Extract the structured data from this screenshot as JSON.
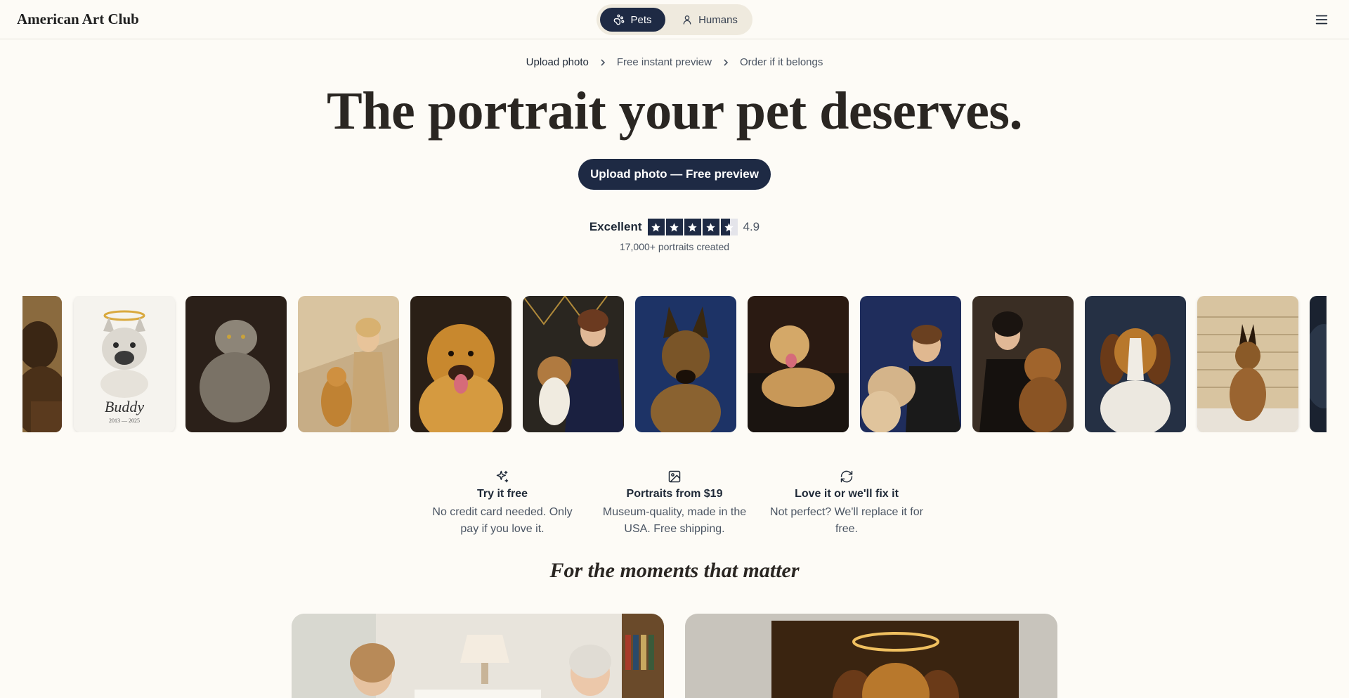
{
  "header": {
    "brand": "American Art Club",
    "toggle": [
      {
        "label": "Pets",
        "icon": "paw-icon",
        "active": true
      },
      {
        "label": "Humans",
        "icon": "person-icon",
        "active": false
      }
    ],
    "menu_icon": "menu-icon"
  },
  "steps": [
    {
      "label": "Upload photo",
      "active": true
    },
    {
      "label": "Free instant preview",
      "active": false
    },
    {
      "label": "Order if it belongs",
      "active": false
    }
  ],
  "hero": {
    "title": "The portrait your pet deserves.",
    "cta": "Upload photo — Free preview"
  },
  "rating": {
    "label": "Excellent",
    "stars": 4.5,
    "score": "4.9",
    "subtext": "17,000+ portraits created"
  },
  "gallery": {
    "tiles": [
      "german-shepherd-portrait-partial",
      "french-bulldog-buddy-memorial",
      "grey-cat-portrait",
      "golden-retriever-with-woman-on-stairs",
      "golden-retriever-portrait",
      "beagle-with-woman-art-deco",
      "german-shepherd-blue-background",
      "labrador-on-leather-chair",
      "boy-with-dog-portrait",
      "woman-with-boxer-dog",
      "beagle-portrait",
      "german-shepherd-on-stairs",
      "dark-portrait-partial"
    ],
    "memorial_name": "Buddy",
    "memorial_dates": "2013 — 2025"
  },
  "features": [
    {
      "icon": "sparkle-icon",
      "title": "Try it free",
      "desc": "No credit card needed. Only pay if you love it."
    },
    {
      "icon": "image-icon",
      "title": "Portraits from $19",
      "desc": "Museum-quality, made in the USA. Free shipping."
    },
    {
      "icon": "refresh-icon",
      "title": "Love it or we'll fix it",
      "desc": "Not perfect? We'll replace it for free."
    }
  ],
  "moments": {
    "title": "For the moments that matter",
    "cards": [
      "family-with-portrait-photo",
      "beagle-memorial-portrait-with-halo"
    ]
  },
  "colors": {
    "background": "#fdfbf6",
    "navy": "#1e2a44",
    "toggle_bg": "#efeade"
  }
}
